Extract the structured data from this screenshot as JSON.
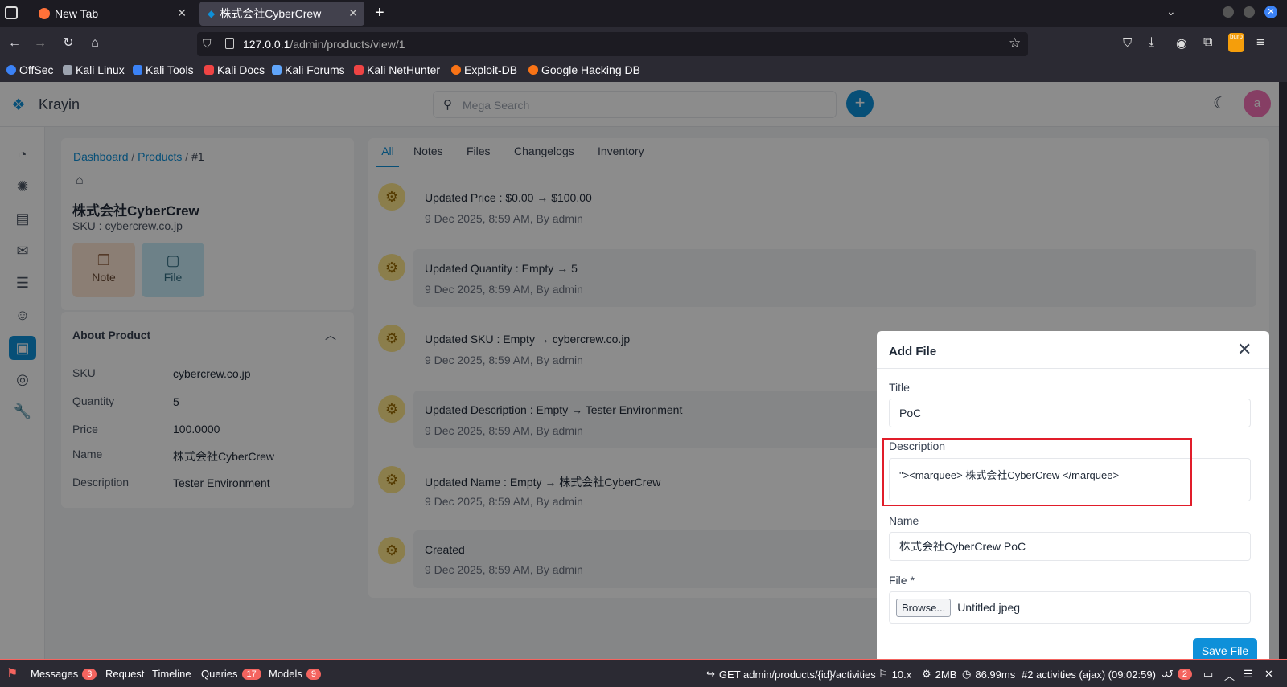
{
  "browser": {
    "tabs": [
      {
        "title": "New Tab"
      },
      {
        "title": "株式会社CyberCrew"
      }
    ],
    "url_host": "127.0.0.1",
    "url_path": "/admin/products/view/1",
    "bookmarks": [
      "OffSec",
      "Kali Linux",
      "Kali Tools",
      "Kali Docs",
      "Kali Forums",
      "Kali NetHunter",
      "Exploit-DB",
      "Google Hacking DB"
    ],
    "extension_label": "burp"
  },
  "app": {
    "brand": "Krayin",
    "search_placeholder": "Mega Search",
    "avatar_letter": "a"
  },
  "product": {
    "breadcrumb": {
      "dashboard": "Dashboard",
      "sep1": " / ",
      "products": "Products",
      "sep2": " / ",
      "current": "#1"
    },
    "name": "株式会社CyberCrew",
    "sku_line": "SKU : cybercrew.co.jp",
    "note_label": "Note",
    "file_label": "File",
    "about_title": "About Product",
    "about": [
      {
        "label": "SKU",
        "value": "cybercrew.co.jp"
      },
      {
        "label": "Quantity",
        "value": "5"
      },
      {
        "label": "Price",
        "value": "100.0000"
      },
      {
        "label": "Name",
        "value": "株式会社CyberCrew"
      },
      {
        "label": "Description",
        "value": "Tester Environment"
      }
    ]
  },
  "tabs": [
    "All",
    "Notes",
    "Files",
    "Changelogs",
    "Inventory"
  ],
  "activities": [
    {
      "title": "Updated Price : $0.00",
      "to": "$100.00",
      "meta": "9 Dec 2025, 8:59 AM, By admin"
    },
    {
      "title": "Updated Quantity : Empty",
      "to": "5",
      "meta": "9 Dec 2025, 8:59 AM, By admin"
    },
    {
      "title": "Updated SKU : Empty",
      "to": "cybercrew.co.jp",
      "meta": "9 Dec 2025, 8:59 AM, By admin"
    },
    {
      "title": "Updated Description : Empty",
      "to": "Tester Environment",
      "meta": "9 Dec 2025, 8:59 AM, By admin"
    },
    {
      "title": "Updated Name : Empty",
      "to": "株式会社CyberCrew",
      "meta": "9 Dec 2025, 8:59 AM, By admin"
    },
    {
      "title": "Created",
      "to": "",
      "meta": "9 Dec 2025, 8:59 AM, By admin"
    }
  ],
  "modal": {
    "title": "Add File",
    "title_label": "Title",
    "title_value": "PoC",
    "description_label": "Description",
    "description_value": "\"><marquee> 株式会社CyberCrew </marquee>",
    "name_label": "Name",
    "name_value": "株式会社CyberCrew PoC",
    "file_label": "File *",
    "browse_label": "Browse...",
    "file_name": "Untitled.jpeg",
    "save_label": "Save File",
    "highlight_color": "#e11d2a"
  },
  "debugbar": {
    "messages": "Messages",
    "messages_count": "3",
    "request": "Request",
    "timeline": "Timeline",
    "queries": "Queries",
    "queries_count": "17",
    "models": "Models",
    "models_count": "9",
    "route": "GET admin/products/{id}/activities",
    "version": "10.x",
    "memory": "2MB",
    "time": "86.99ms",
    "activity": "#2 activities (ajax) (09:02:59)",
    "history_count": "2"
  },
  "colors": {
    "primary": "#0e90d9",
    "accent_red": "#f4645f"
  }
}
